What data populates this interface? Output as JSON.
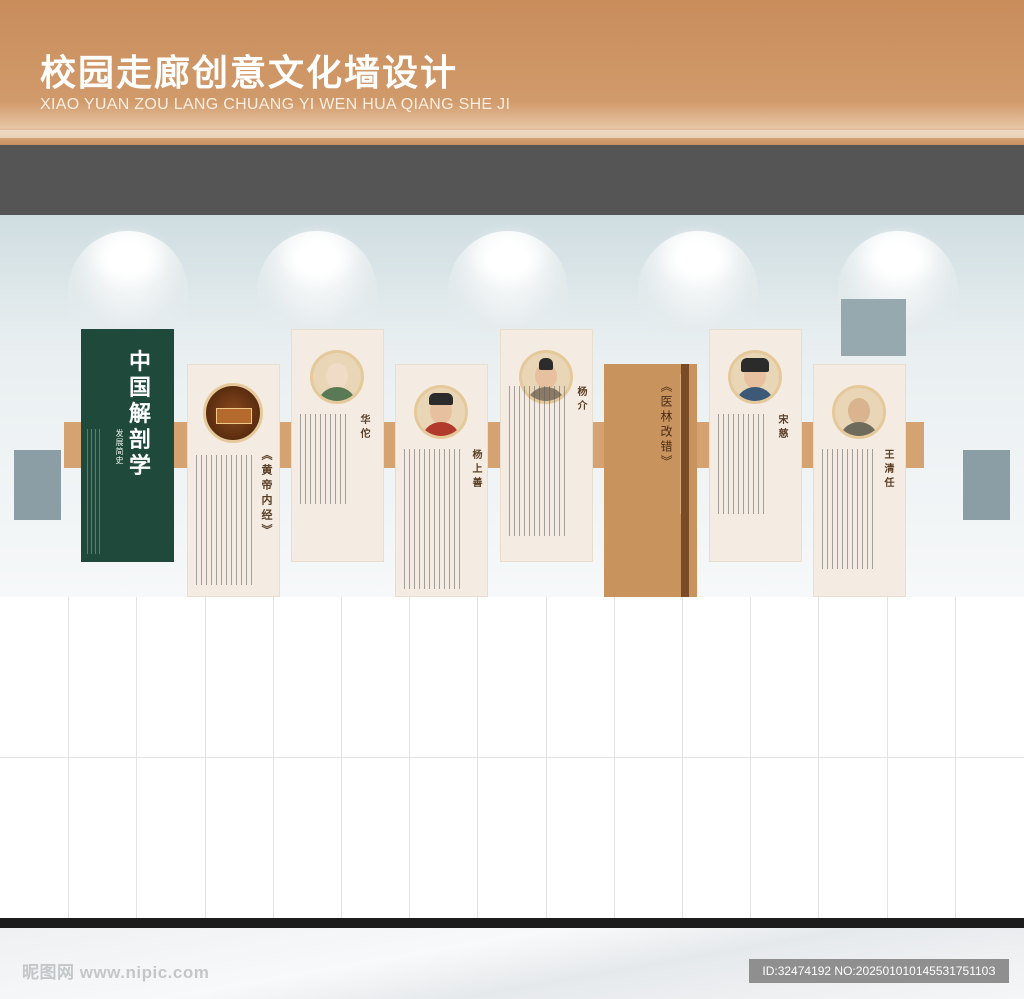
{
  "header": {
    "title": "校园走廊创意文化墙设计",
    "subtitle": "XIAO YUAN ZOU LANG CHUANG YI  WEN HUA QIANG SHE JI"
  },
  "intro": {
    "title": "中国解剖学",
    "subtitle": "发展简史"
  },
  "panels": [
    {
      "name": "《黄帝内经》"
    },
    {
      "name": "华佗"
    },
    {
      "name": "杨上善"
    },
    {
      "name": "杨介"
    },
    {
      "name": "宋慈"
    },
    {
      "name": "王清任"
    }
  ],
  "feature": {
    "title": "《医林改错》"
  },
  "watermark": {
    "site": "昵图网 www.nipic.com",
    "id": "ID:32474192 NO:20250101014553175110З"
  },
  "colors": {
    "header": "#c98d5c",
    "ceiling": "#555555",
    "intro_panel": "#1f4a3b",
    "wood": "#c9935e",
    "panel": "#f4ece2"
  }
}
